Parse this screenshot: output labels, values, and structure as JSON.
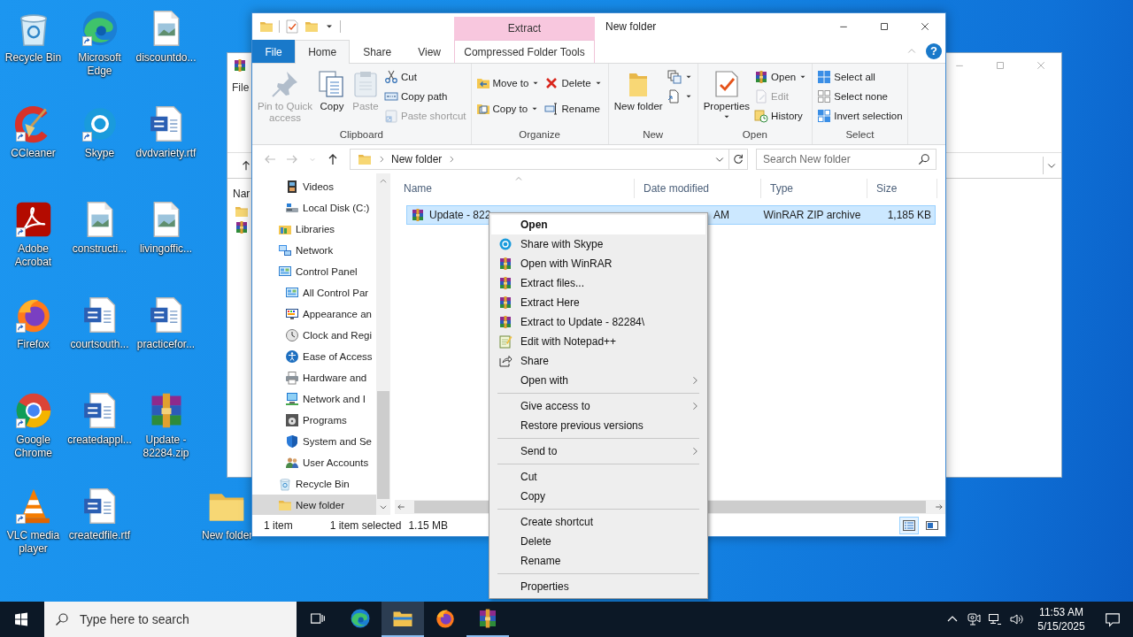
{
  "desktop": {
    "icons": [
      {
        "label": "Recycle Bin",
        "kind": "recycle-bin",
        "shortcut": false
      },
      {
        "label": "CCleaner",
        "kind": "cleaner",
        "shortcut": true
      },
      {
        "label": "Adobe Acrobat",
        "kind": "pdf",
        "shortcut": true
      },
      {
        "label": "Firefox",
        "kind": "fox",
        "shortcut": true
      },
      {
        "label": "Google Chrome",
        "kind": "chrome",
        "shortcut": true
      },
      {
        "label": "VLC media player",
        "kind": "cone",
        "shortcut": true
      },
      {
        "label": "Microsoft Edge",
        "kind": "edge",
        "shortcut": true
      },
      {
        "label": "Skype",
        "kind": "chat",
        "shortcut": true
      },
      {
        "label": "constructi...",
        "kind": "image-file",
        "shortcut": false
      },
      {
        "label": "courtsouth...",
        "kind": "word",
        "shortcut": false
      },
      {
        "label": "createdappl...",
        "kind": "word",
        "shortcut": false
      },
      {
        "label": "createdfile.rtf",
        "kind": "word",
        "shortcut": false
      },
      {
        "label": "discountdo...",
        "kind": "image-file",
        "shortcut": false
      },
      {
        "label": "dvdvariety.rtf",
        "kind": "word",
        "shortcut": false
      },
      {
        "label": "livingoffic...",
        "kind": "image-file",
        "shortcut": false
      },
      {
        "label": "practicefor...",
        "kind": "word",
        "shortcut": false
      },
      {
        "label": "Update - 82284.zip",
        "kind": "archive",
        "shortcut": false
      }
    ],
    "loose_icon": {
      "label": "New folder",
      "kind": "folder",
      "shortcut": false
    }
  },
  "background_window": {
    "menu_label": "File",
    "column_label": "Nar"
  },
  "explorer": {
    "title": "New folder",
    "context_header": "Extract",
    "tabs": [
      {
        "label": "File",
        "kind": "file",
        "selected": false
      },
      {
        "label": "Home",
        "kind": "normal",
        "selected": true
      },
      {
        "label": "Share",
        "kind": "normal",
        "selected": false
      },
      {
        "label": "View",
        "kind": "normal",
        "selected": false
      },
      {
        "label": "Compressed Folder Tools",
        "kind": "context",
        "selected": false
      }
    ],
    "help_label": "?",
    "ribbon_groups": [
      {
        "label": "Clipboard",
        "columns": [
          {
            "kind": "large",
            "items": [
              {
                "label": "Pin to Quick access",
                "kind": "pin",
                "disabled": true,
                "menu": false
              }
            ]
          },
          {
            "kind": "large",
            "items": [
              {
                "label": "Copy",
                "kind": "copy",
                "disabled": false,
                "menu": false
              }
            ]
          },
          {
            "kind": "large",
            "items": [
              {
                "label": "Paste",
                "kind": "paste",
                "disabled": true,
                "menu": false
              }
            ]
          },
          {
            "kind": "stack",
            "items": [
              {
                "label": "Cut",
                "kind": "cut",
                "disabled": false,
                "menu": false
              },
              {
                "label": "Copy path",
                "kind": "copypath",
                "disabled": false,
                "menu": false
              },
              {
                "label": "Paste shortcut",
                "kind": "pasteshort",
                "disabled": true,
                "menu": false
              }
            ]
          }
        ]
      },
      {
        "label": "Organize",
        "columns": [
          {
            "kind": "pair",
            "items": [
              {
                "label": "Move to",
                "kind": "moveto",
                "disabled": false,
                "menu": true
              },
              {
                "label": "Copy to",
                "kind": "copyto",
                "disabled": false,
                "menu": true
              }
            ]
          },
          {
            "kind": "pair",
            "items": [
              {
                "label": "Delete",
                "kind": "delete",
                "disabled": false,
                "menu": true
              },
              {
                "label": "Rename",
                "kind": "rename",
                "disabled": false,
                "menu": false
              }
            ]
          }
        ]
      },
      {
        "label": "New",
        "columns": [
          {
            "kind": "large",
            "items": [
              {
                "label": "New folder",
                "kind": "newfolder",
                "disabled": false,
                "menu": false
              }
            ]
          },
          {
            "kind": "stack",
            "items": [
              {
                "kind": "newitem",
                "disabled": false,
                "menu": true
              },
              {
                "kind": "easy",
                "disabled": false,
                "menu": true
              }
            ]
          }
        ]
      },
      {
        "label": "Open",
        "columns": [
          {
            "kind": "large",
            "items": [
              {
                "label": "Properties",
                "kind": "properties",
                "disabled": false,
                "menu": true
              }
            ]
          },
          {
            "kind": "stack",
            "items": [
              {
                "label": "Open",
                "kind": "archive",
                "disabled": false,
                "menu": true
              },
              {
                "label": "Edit",
                "kind": "edit",
                "disabled": true,
                "menu": false
              },
              {
                "label": "History",
                "kind": "history",
                "disabled": false,
                "menu": false
              }
            ]
          }
        ]
      },
      {
        "label": "Select",
        "columns": [
          {
            "kind": "stack",
            "items": [
              {
                "label": "Select all",
                "kind": "selectall",
                "disabled": false,
                "menu": false
              },
              {
                "label": "Select none",
                "kind": "selectnone",
                "disabled": false,
                "menu": false
              },
              {
                "label": "Invert selection",
                "kind": "invert",
                "disabled": false,
                "menu": false
              }
            ]
          }
        ]
      }
    ],
    "nav_buttons": [
      {
        "kind": "back",
        "disabled": true
      },
      {
        "kind": "forward",
        "disabled": true
      },
      {
        "kind": "recent",
        "disabled": true
      },
      {
        "kind": "up",
        "disabled": false
      }
    ],
    "address": {
      "path": [
        "New folder"
      ],
      "search_placeholder": "Search New folder"
    },
    "nav_tree": [
      {
        "children": [
          {
            "label": "Videos",
            "kind": "film",
            "selected": false
          },
          {
            "label": "Local Disk (C:)",
            "kind": "drive",
            "selected": false
          }
        ]
      },
      {
        "label": "Libraries",
        "kind": "library",
        "selected": false
      },
      {
        "label": "Network",
        "kind": "network",
        "selected": false
      },
      {
        "label": "Control Panel",
        "kind": "panel",
        "selected": false,
        "children": [
          {
            "label": "All Control Par",
            "kind": "panel",
            "selected": false
          },
          {
            "label": "Appearance an",
            "kind": "appearance",
            "selected": false
          },
          {
            "label": "Clock and Regi",
            "kind": "clock",
            "selected": false
          },
          {
            "label": "Ease of Access",
            "kind": "ease",
            "selected": false
          },
          {
            "label": "Hardware and",
            "kind": "printer",
            "selected": false
          },
          {
            "label": "Network and I",
            "kind": "netshare",
            "selected": false
          },
          {
            "label": "Programs",
            "kind": "programs",
            "selected": false
          },
          {
            "label": "System and Se",
            "kind": "shield",
            "selected": false
          },
          {
            "label": "User Accounts",
            "kind": "users",
            "selected": false
          }
        ]
      },
      {
        "label": "Recycle Bin",
        "kind": "recycle-bin",
        "selected": false
      },
      {
        "label": "New folder",
        "kind": "folder",
        "selected": true
      }
    ],
    "columns": [
      {
        "label": "Name",
        "sorted": true
      },
      {
        "label": "Date modified",
        "sorted": false
      },
      {
        "label": "Type",
        "sorted": false
      },
      {
        "label": "Size",
        "sorted": false
      }
    ],
    "rows": [
      {
        "name": "Update - 822",
        "date": "AM",
        "type": "WinRAR ZIP archive",
        "size": "1,185 KB",
        "kind": "archive",
        "selected": true
      }
    ],
    "status_bar": {
      "item_count": "1 item",
      "selection": "1 item selected",
      "selection_size": "1.15 MB",
      "views": [
        {
          "kind": "details",
          "selected": true
        },
        {
          "kind": "preview",
          "selected": false
        }
      ]
    }
  },
  "context_menu": {
    "items": [
      {
        "kind": "item",
        "label": "Open",
        "default": true,
        "highlighted": true,
        "submenu": false
      },
      {
        "kind": "chat",
        "label": "Share with Skype",
        "default": false,
        "highlighted": false,
        "submenu": false
      },
      {
        "kind": "archive",
        "label": "Open with WinRAR",
        "default": false,
        "highlighted": false,
        "submenu": false
      },
      {
        "kind": "archive",
        "label": "Extract files...",
        "default": false,
        "highlighted": false,
        "submenu": false
      },
      {
        "kind": "archive",
        "label": "Extract Here",
        "default": false,
        "highlighted": false,
        "submenu": false
      },
      {
        "kind": "archive",
        "label": "Extract to Update - 82284\\",
        "default": false,
        "highlighted": false,
        "submenu": false
      },
      {
        "kind": "notepad",
        "label": "Edit with Notepad++",
        "default": false,
        "highlighted": false,
        "submenu": false
      },
      {
        "kind": "share",
        "label": "Share",
        "default": false,
        "highlighted": false,
        "submenu": false
      },
      {
        "kind": "item",
        "label": "Open with",
        "default": false,
        "highlighted": false,
        "submenu": true
      },
      {
        "kind": "separator"
      },
      {
        "kind": "item",
        "label": "Give access to",
        "default": false,
        "highlighted": false,
        "submenu": true
      },
      {
        "kind": "item",
        "label": "Restore previous versions",
        "default": false,
        "highlighted": false,
        "submenu": false
      },
      {
        "kind": "separator"
      },
      {
        "kind": "item",
        "label": "Send to",
        "default": false,
        "highlighted": false,
        "submenu": true
      },
      {
        "kind": "separator"
      },
      {
        "kind": "item",
        "label": "Cut",
        "default": false,
        "highlighted": false,
        "submenu": false
      },
      {
        "kind": "item",
        "label": "Copy",
        "default": false,
        "highlighted": false,
        "submenu": false
      },
      {
        "kind": "separator"
      },
      {
        "kind": "item",
        "label": "Create shortcut",
        "default": false,
        "highlighted": false,
        "submenu": false
      },
      {
        "kind": "item",
        "label": "Delete",
        "default": false,
        "highlighted": false,
        "submenu": false
      },
      {
        "kind": "item",
        "label": "Rename",
        "default": false,
        "highlighted": false,
        "submenu": false
      },
      {
        "kind": "separator"
      },
      {
        "kind": "item",
        "label": "Properties",
        "default": false,
        "highlighted": false,
        "submenu": false
      }
    ]
  },
  "taskbar": {
    "search_placeholder": "Type here to search",
    "apps": [
      {
        "kind": "taskview",
        "active": false,
        "running": false
      },
      {
        "kind": "edge",
        "active": false,
        "running": false
      },
      {
        "kind": "explorer",
        "active": true,
        "running": true
      },
      {
        "kind": "fox",
        "active": false,
        "running": false
      },
      {
        "kind": "archive",
        "active": false,
        "running": true
      }
    ],
    "time": "11:53 AM",
    "date": "5/15/2025"
  }
}
